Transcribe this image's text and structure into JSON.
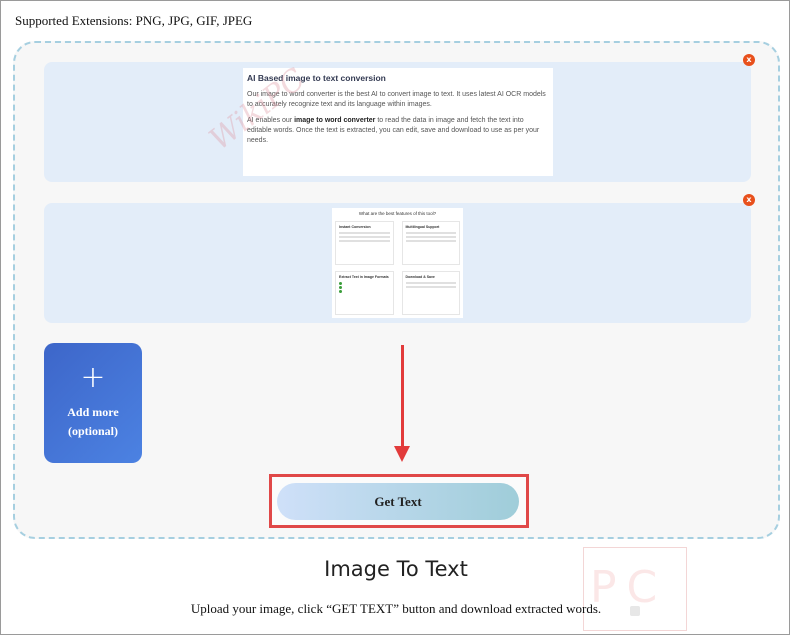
{
  "supported_extensions": "Supported Extensions: PNG, JPG, GIF, JPEG",
  "previews": [
    {
      "remove_symbol": "x",
      "heading": "AI Based image to text conversion",
      "para1": "Our image to word converter is the best AI to convert image to text. It uses latest AI OCR models to accurately recognize text and its language within images.",
      "para2_pre": "AI enables our ",
      "para2_bold": "image to word converter",
      "para2_post": " to read the data in image and fetch the text into editable words. Once the text is extracted, you can edit, save and download to use as per your needs."
    },
    {
      "remove_symbol": "x",
      "heading": "What are the best features of this tool?",
      "features": [
        "Instant Conversion",
        "Multilingual Support",
        "Extract Text in Image Formats",
        "Download & Save"
      ]
    }
  ],
  "add_more": {
    "icon": "+",
    "label": "Add more (optional)"
  },
  "get_text_button": "Get Text",
  "page_title": "Image To Text",
  "description": "Upload your image, click “GET TEXT” button and download extracted words.",
  "logo": {
    "text": "PC"
  }
}
